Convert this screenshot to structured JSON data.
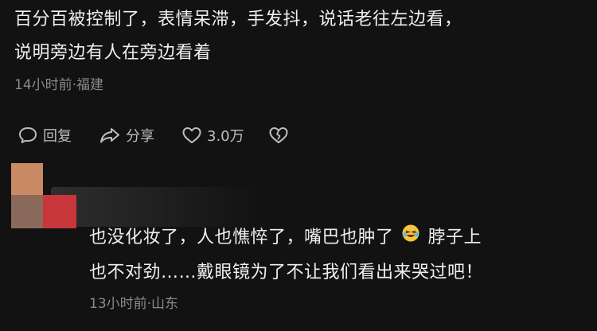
{
  "comment1": {
    "text": "百分百被控制了，表情呆滞，手发抖，说话老往左边看，\n说明旁边有人在旁边看着",
    "meta": "14小时前·福建"
  },
  "actions": {
    "reply_label": "回复",
    "share_label": "分享",
    "like_count": "3.0万"
  },
  "comment2": {
    "text_part1": "也没化妆了，人也憔悴了，嘴巴也肿了",
    "text_part2": "脖子上\n也不对劲……戴眼镜为了不让我们看出来哭过吧！",
    "emoji": "laughing-crying-emoji",
    "meta": "13小时前·山东"
  },
  "avatar": {
    "colors": [
      "#c98a64",
      "#8a6a5a",
      "#b55d46",
      "#c7363a"
    ]
  },
  "colors": {
    "background": "#121212",
    "text": "#efefef",
    "meta": "#8a8a8a",
    "action": "#bdbdbd"
  }
}
